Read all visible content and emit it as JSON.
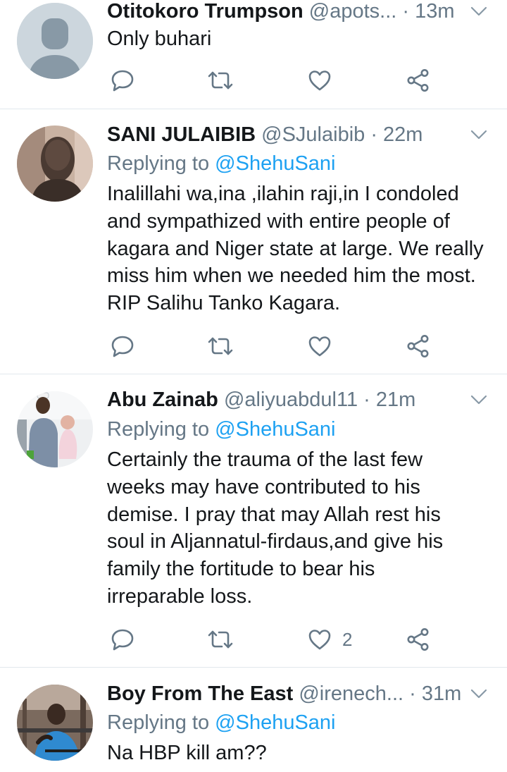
{
  "tweets": [
    {
      "name": "Otitokoro Trumpson",
      "handle": "@apots...",
      "time": "13m",
      "reply_prefix": "",
      "reply_to": "",
      "lines": [
        "Only buhari"
      ],
      "like_count": ""
    },
    {
      "name": "SANI JULAIBIB",
      "handle": "@SJulaibib",
      "time": "22m",
      "reply_prefix": "Replying to ",
      "reply_to": "@ShehuSani",
      "lines": [
        "Inalillahi wa,ina ,ilahin raji,in I condoled",
        "and sympathized with entire people of",
        "kagara and Niger state at large. We really",
        "miss him when we needed him the most.",
        "RIP Salihu Tanko Kagara."
      ],
      "like_count": ""
    },
    {
      "name": "Abu Zainab",
      "handle": "@aliyuabdul11",
      "time": "21m",
      "reply_prefix": "Replying to ",
      "reply_to": "@ShehuSani",
      "lines": [
        "Certainly the trauma of the last few",
        "weeks may have contributed to his",
        "demise. I pray that may Allah rest his",
        "soul in Aljannatul-firdaus,and give his",
        "family the fortitude to bear his",
        "irreparable loss."
      ],
      "like_count": "2"
    },
    {
      "name": "Boy From The East",
      "handle": "@irenech...",
      "time": "31m",
      "reply_prefix": "Replying to ",
      "reply_to": "@ShehuSani",
      "lines": [
        "Na HBP kill am??"
      ],
      "like_count": ""
    }
  ],
  "separator": " · ",
  "icons": {
    "reply": "reply-icon",
    "retweet": "retweet-icon",
    "like": "heart-icon",
    "share": "share-icon",
    "menu": "chevron-down-icon"
  },
  "colors": {
    "text": "#14171a",
    "secondary": "#657786",
    "link": "#1da1f2",
    "divider": "#e1e8ed"
  }
}
